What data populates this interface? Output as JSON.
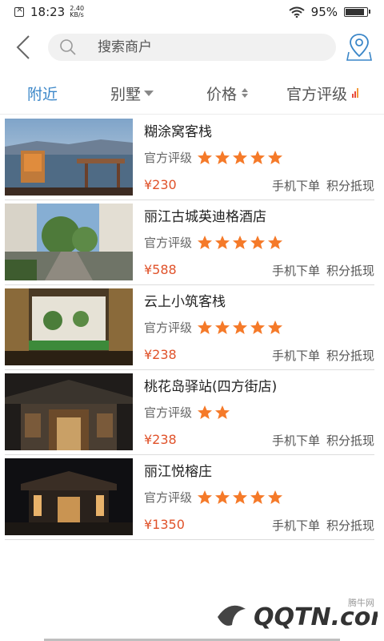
{
  "status": {
    "time": "18:23",
    "net_speed_value": "2.40",
    "net_speed_unit": "KB/s",
    "battery": "95%",
    "battery_level": 0.95
  },
  "search": {
    "placeholder": "搜索商户"
  },
  "filters": [
    {
      "label": "附近",
      "active": true
    },
    {
      "label": "别墅"
    },
    {
      "label": "价格"
    },
    {
      "label": "官方评级"
    }
  ],
  "colors": {
    "accent": "#3a86c8",
    "star": "#f57a29",
    "price": "#e0522a",
    "rating_bar_red": "#e84a3b",
    "rating_bar_orange": "#f39a3a"
  },
  "listing_rating_label": "官方评级",
  "listings": [
    {
      "name": "糊涂窝客栈",
      "stars": 5,
      "price": "¥230",
      "tag_mobile": "手机下单",
      "tag_points": "积分抵现"
    },
    {
      "name": "丽江古城英迪格酒店",
      "stars": 5,
      "price": "¥588",
      "tag_mobile": "手机下单",
      "tag_points": "积分抵现"
    },
    {
      "name": "云上小筑客栈",
      "stars": 5,
      "price": "¥238",
      "tag_mobile": "手机下单",
      "tag_points": "积分抵现"
    },
    {
      "name": "桃花岛驿站(四方街店)",
      "stars": 2,
      "price": "¥238",
      "tag_mobile": "手机下单",
      "tag_points": "积分抵现"
    },
    {
      "name": "丽江悦榕庄",
      "stars": 5,
      "price": "¥1350",
      "tag_mobile": "手机下单",
      "tag_points": "积分抵现"
    }
  ],
  "watermark": {
    "brand": "腾牛网",
    "logo_text": "QQTN.com"
  }
}
